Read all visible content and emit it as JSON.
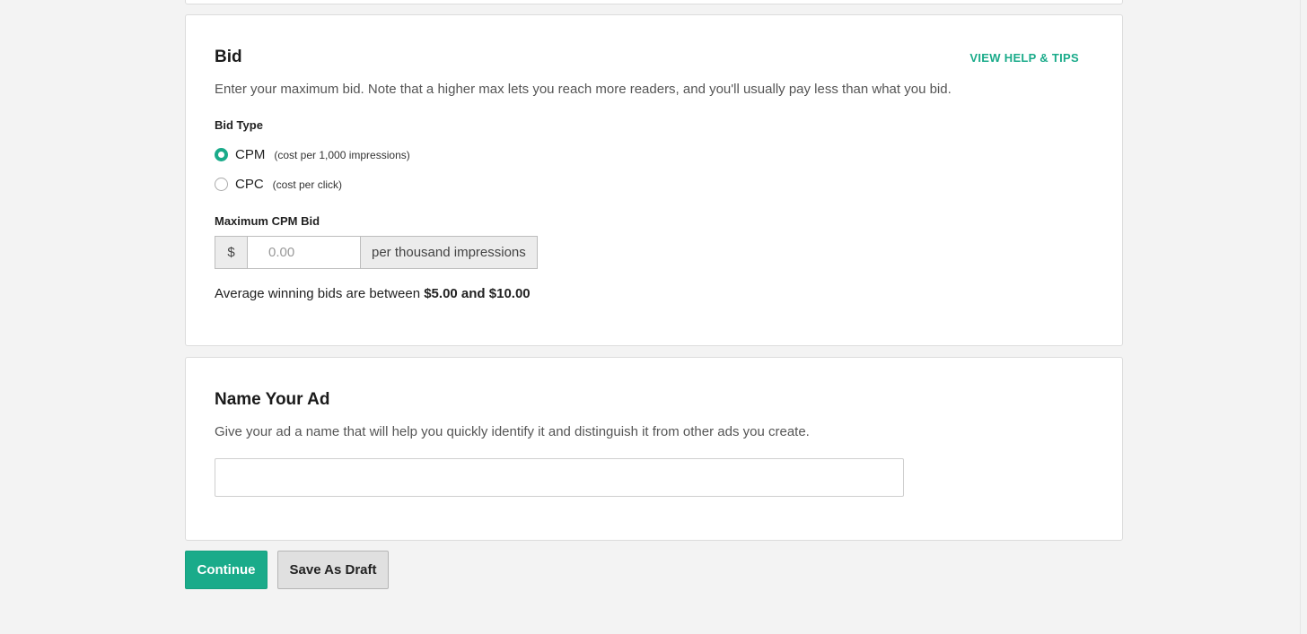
{
  "bid_section": {
    "title": "Bid",
    "help_link": "VIEW HELP & TIPS",
    "description": "Enter your maximum bid. Note that a higher max lets you reach more readers, and you'll usually pay less than what you bid.",
    "bid_type_label": "Bid Type",
    "options": [
      {
        "label": "CPM",
        "hint": "(cost per 1,000 impressions)",
        "selected": true
      },
      {
        "label": "CPC",
        "hint": "(cost per click)",
        "selected": false
      }
    ],
    "max_bid_label": "Maximum CPM Bid",
    "currency_symbol": "$",
    "bid_placeholder": "0.00",
    "bid_value": "",
    "unit_suffix": "per thousand impressions",
    "average_prefix": "Average winning bids are between",
    "average_range": "$5.00 and $10.00"
  },
  "name_section": {
    "title": "Name Your Ad",
    "description": "Give your ad a name that will help you quickly identify it and distinguish it from other ads you create.",
    "name_value": ""
  },
  "actions": {
    "continue_label": "Continue",
    "draft_label": "Save As Draft"
  },
  "colors": {
    "accent": "#1aab8a",
    "page_background": "#f3f3f3"
  }
}
